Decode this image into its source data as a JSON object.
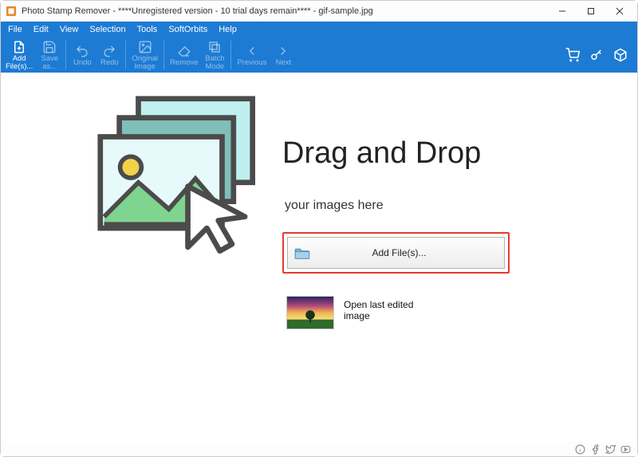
{
  "window": {
    "title": "Photo Stamp Remover - ****Unregistered version - 10 trial days remain**** - gif-sample.jpg"
  },
  "menu": {
    "items": [
      "File",
      "Edit",
      "View",
      "Selection",
      "Tools",
      "SoftOrbits",
      "Help"
    ]
  },
  "toolbar": {
    "add_files": "Add\nFile(s)...",
    "save_as": "Save\nas...",
    "undo": "Undo",
    "redo": "Redo",
    "original_image": "Original\nImage",
    "remove": "Remove",
    "batch_mode": "Batch\nMode",
    "previous": "Previous",
    "next": "Next"
  },
  "main": {
    "heading": "Drag and Drop",
    "subheading": "your images here",
    "add_files_button": "Add File(s)...",
    "open_last": "Open last edited image"
  }
}
